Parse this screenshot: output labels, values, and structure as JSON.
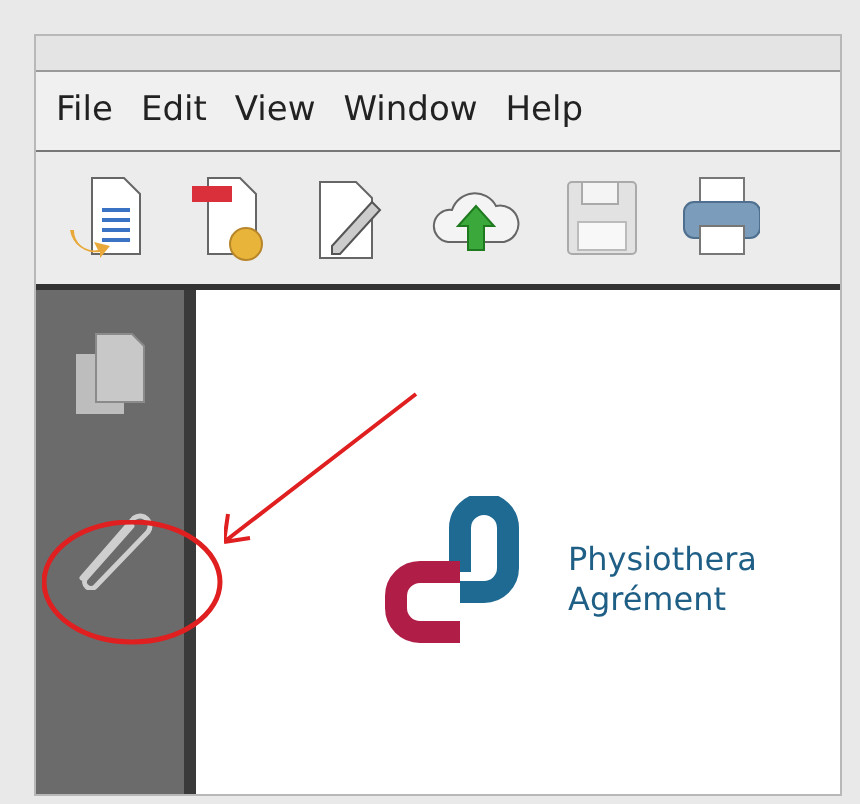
{
  "menu_bar": [
    {
      "label": "File"
    },
    {
      "label": "Edit"
    },
    {
      "label": "View"
    },
    {
      "label": "Window"
    },
    {
      "label": "Help"
    }
  ],
  "document": {
    "logo_lines": [
      "Physiothera",
      "Agrément"
    ]
  }
}
